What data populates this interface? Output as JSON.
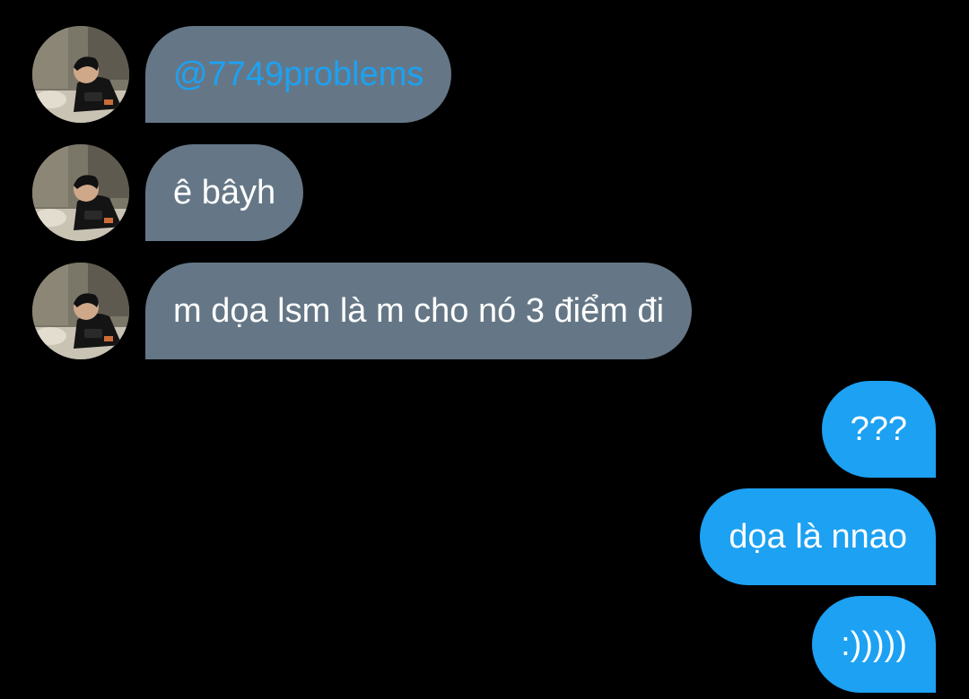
{
  "conversation": {
    "received": [
      {
        "text": "@7749problems",
        "is_mention": true
      },
      {
        "text": "ê bâyh",
        "is_mention": false
      },
      {
        "text": "m dọa lsm là m cho nó 3 điểm đi",
        "is_mention": false
      }
    ],
    "sent": [
      {
        "text": "???"
      },
      {
        "text": "dọa là nnao"
      },
      {
        "text": ":)))))"
      }
    ]
  },
  "colors": {
    "background": "#000000",
    "received_bubble": "#657786",
    "sent_bubble": "#1da1f2",
    "mention_text": "#1da1f2",
    "message_text": "#ffffff"
  },
  "icons": {
    "avatar": "profile-photo-avatar-icon"
  }
}
